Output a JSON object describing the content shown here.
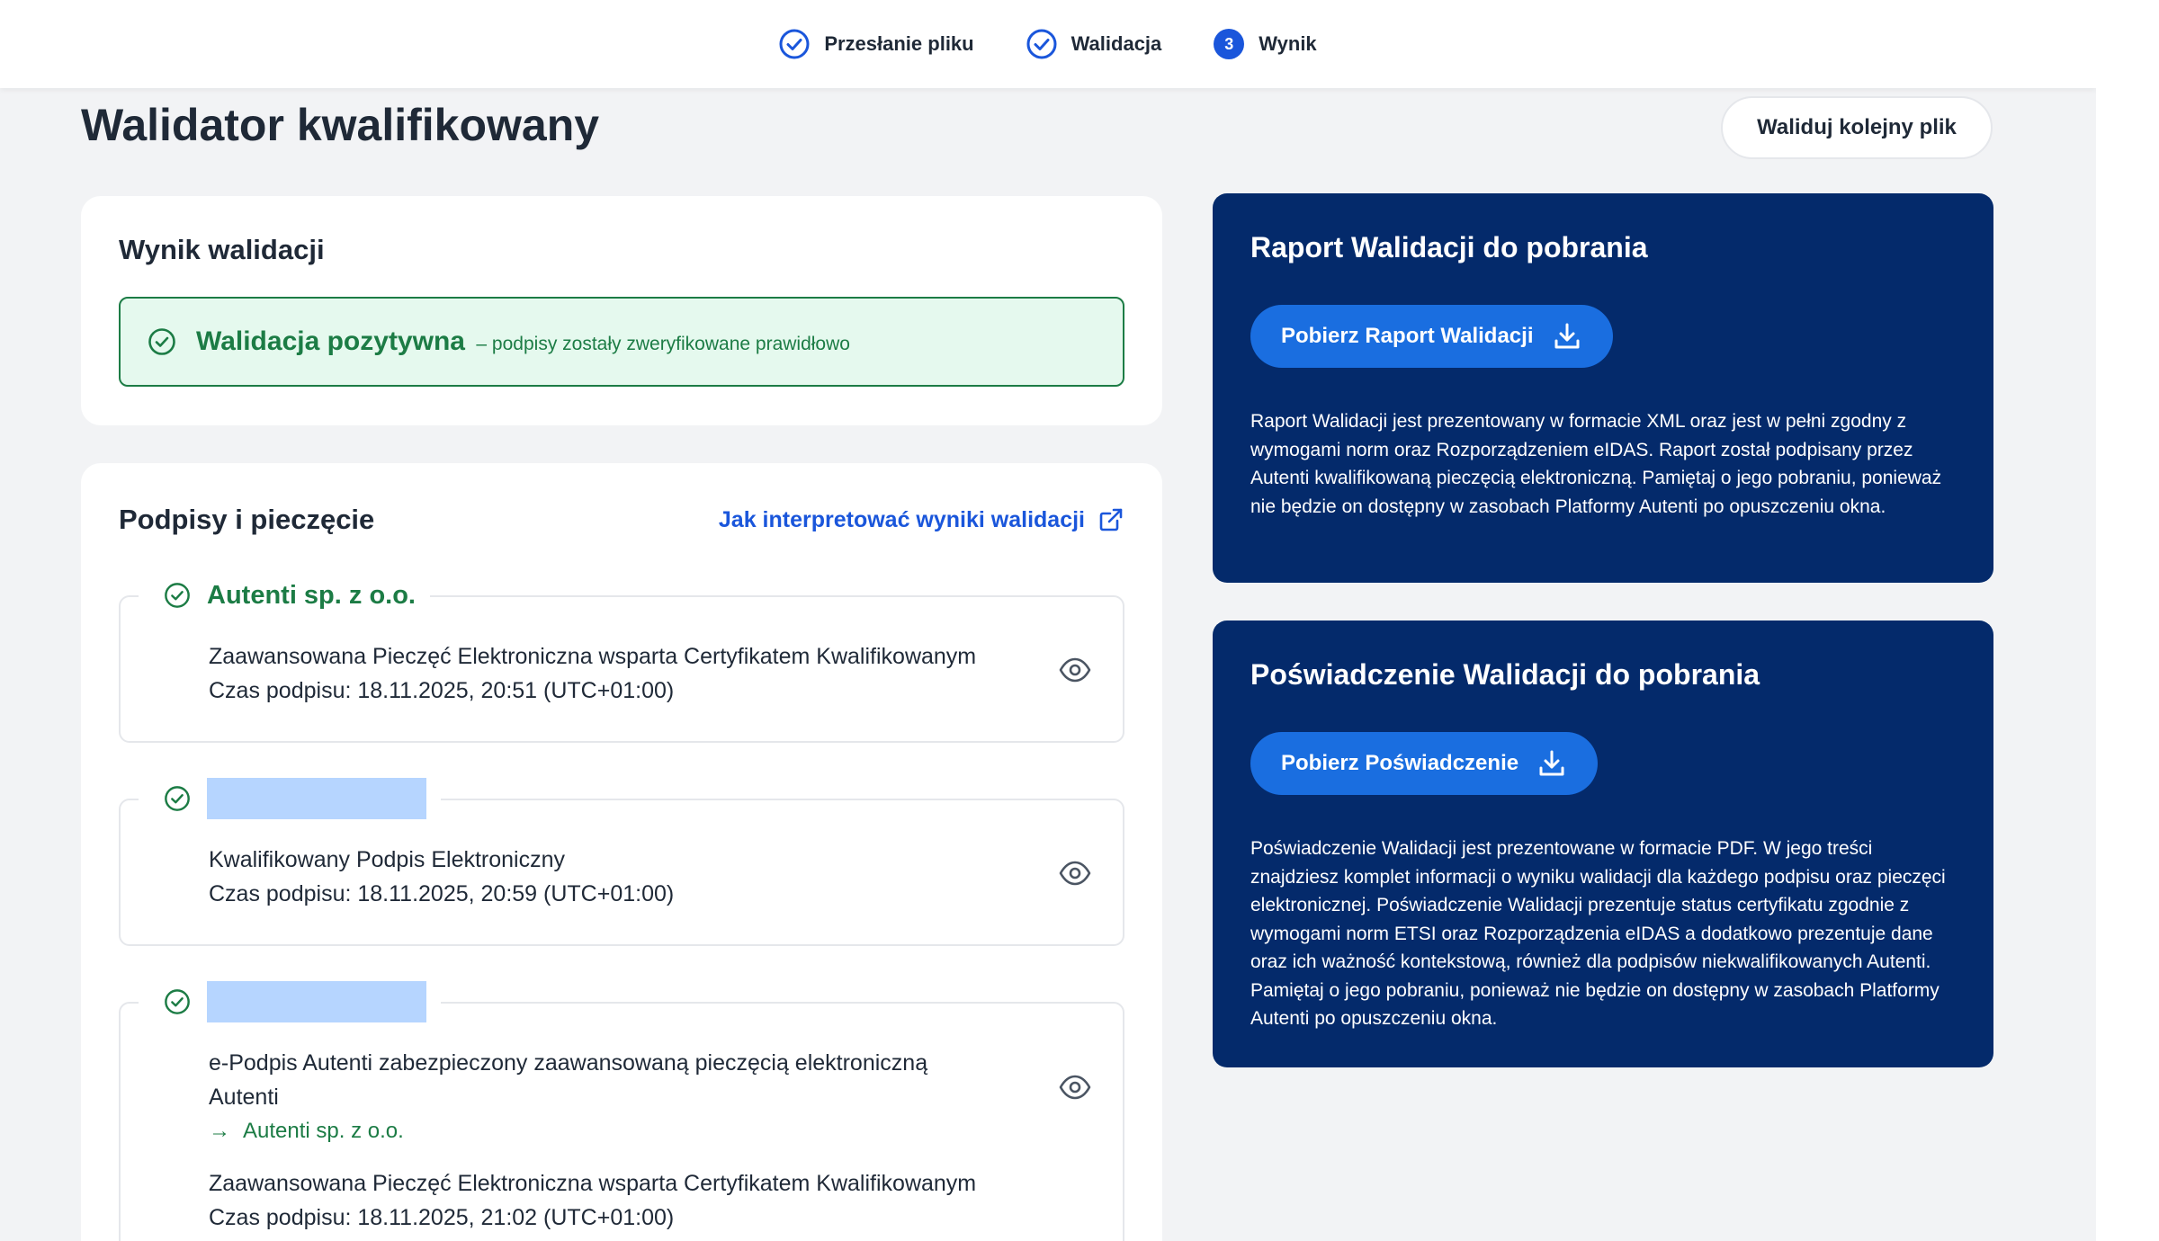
{
  "stepper": {
    "steps": [
      {
        "label": "Przesłanie pliku",
        "state": "done"
      },
      {
        "label": "Walidacja",
        "state": "done"
      },
      {
        "label": "Wynik",
        "state": "current",
        "number": "3"
      }
    ]
  },
  "page": {
    "title": "Walidator kwalifikowany",
    "validate_next_label": "Waliduj kolejny plik"
  },
  "result": {
    "title": "Wynik walidacji",
    "status_main": "Walidacja pozytywna",
    "status_sub": "– podpisy zostały zweryfikowane prawidłowo"
  },
  "signatures": {
    "title": "Podpisy i pieczęcie",
    "help_link": "Jak interpretować wyniki walidacji",
    "items": [
      {
        "name": "Autenti sp. z o.o.",
        "type": "Zaawansowana Pieczęć Elektroniczna wsparta Certyfikatem Kwalifikowanym",
        "time": "Czas podpisu: 18.11.2025, 20:51 (UTC+01:00)"
      },
      {
        "name": "",
        "type": "Kwalifikowany Podpis Elektroniczny",
        "time": "Czas podpisu: 18.11.2025, 20:59 (UTC+01:00)"
      },
      {
        "name": "",
        "type_line1": "e-Podpis Autenti zabezpieczony zaawansowaną pieczęcią elektroniczną",
        "type_line2": "Autenti",
        "chain_arrow": "→",
        "chain": "Autenti sp. z o.o.",
        "type": "Zaawansowana Pieczęć Elektroniczna wsparta Certyfikatem Kwalifikowanym",
        "time": "Czas podpisu: 18.11.2025, 21:02 (UTC+01:00)"
      }
    ]
  },
  "report": {
    "title": "Raport Walidacji do pobrania",
    "button": "Pobierz Raport Walidacji",
    "description": "Raport Walidacji jest prezentowany w formacie XML oraz jest w pełni zgodny z wymogami norm oraz Rozporządzeniem eIDAS. Raport został podpisany przez Autenti kwalifikowaną pieczęcią elektroniczną. Pamiętaj o jego pobraniu, ponieważ nie będzie on dostępny w zasobach Platformy Autenti po opuszczeniu okna."
  },
  "certificate": {
    "title": "Poświadczenie Walidacji do pobrania",
    "button": "Pobierz Poświadczenie",
    "description": "Poświadczenie Walidacji jest prezentowane w formacie PDF. W jego treści znajdziesz komplet informacji o wyniku walidacji dla każdego podpisu oraz pieczęci elektronicznej. Poświadczenie Walidacji prezentuje status certyfikatu zgodnie z wymogami norm ETSI oraz Rozporządzenia eIDAS a dodatkowo prezentuje dane oraz ich ważność kontekstową, również dla podpisów niekwalifikowanych Autenti. Pamiętaj o jego pobraniu, ponieważ nie będzie on dostępny w zasobach Platformy Autenti po opuszczeniu okna."
  },
  "colors": {
    "primary": "#1a56db",
    "success": "#1c7c45",
    "success_bg": "#e5f9ee",
    "navy": "#042a6b",
    "redaction": "#b6d5ff"
  },
  "icons": [
    "check-circle-icon",
    "external-link-icon",
    "eye-icon",
    "download-icon",
    "arrow-right-icon"
  ]
}
